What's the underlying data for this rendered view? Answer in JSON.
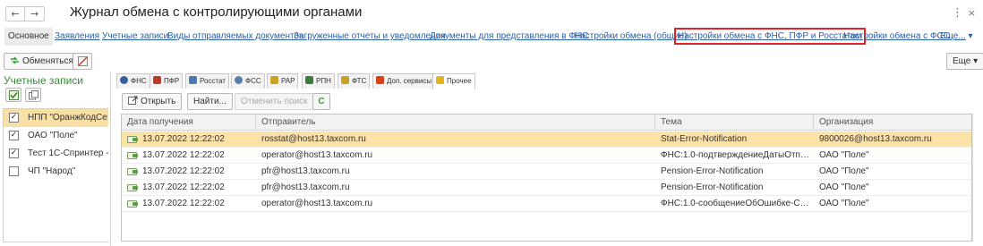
{
  "window": {
    "title": "Журнал обмена с контролирующими органами",
    "back_glyph": "←",
    "forward_glyph": "→",
    "more_glyph": "⋮",
    "close_glyph": "×"
  },
  "nav": {
    "items": [
      {
        "label": "Основное",
        "active": true
      },
      {
        "label": "Заявления"
      },
      {
        "label": "Учетные записи"
      },
      {
        "label": "Виды отправляемых документов"
      },
      {
        "label": "Загруженные отчеты и уведомления"
      },
      {
        "label": "Документы для представления в ФНС"
      },
      {
        "label": "Настройки обмена (общие)"
      },
      {
        "label": "Настройки обмена с ФНС, ПФР и Росстатом",
        "highlighted": true
      },
      {
        "label": "Настройки обмена с ФСС"
      },
      {
        "label": "Еще..."
      }
    ],
    "more_arrow": "▾",
    "highlight_color": "#e2232a"
  },
  "toolbar": {
    "exchange_label": "Обменяться",
    "more_label": "Еще",
    "more_arrow": "▾"
  },
  "accounts": {
    "title": "Учетные записи",
    "items": [
      {
        "label": "НПП \"ОранжКодСе...",
        "checked": true,
        "selected": true
      },
      {
        "label": "ОАО \"Поле\"",
        "checked": true
      },
      {
        "label": "Тест 1С-Спринтер - ...",
        "checked": true
      },
      {
        "label": "ЧП \"Народ\"",
        "checked": false
      }
    ],
    "check_glyph": "✓"
  },
  "tabs": [
    {
      "label": "ФНС",
      "icon": "fns-icon",
      "color": "#3a5fa0"
    },
    {
      "label": "ПФР",
      "icon": "pfr-icon",
      "color": "#c0392b"
    },
    {
      "label": "Росстат",
      "icon": "rosstat-icon",
      "color": "#4a7ab0"
    },
    {
      "label": "ФСС",
      "icon": "fss-icon",
      "color": "#5a7ea8"
    },
    {
      "label": "РАР",
      "icon": "rar-icon",
      "color": "#c9a227"
    },
    {
      "label": "РПН",
      "icon": "rpn-icon",
      "color": "#3b7d3b"
    },
    {
      "label": "ФТС",
      "icon": "fts-icon",
      "color": "#c9a227"
    },
    {
      "label": "Доп. сервисы",
      "icon": "services-icon",
      "color": "#d84315"
    },
    {
      "label": "Прочее",
      "icon": "other-icon",
      "color": "#e6b422",
      "active": true
    }
  ],
  "actions": {
    "open_label": "Открыть",
    "find_label": "Найти...",
    "cancel_search_label": "Отменить поиск",
    "refresh_glyph": "C"
  },
  "grid": {
    "columns": [
      "Дата получения",
      "Отправитель",
      "Тема",
      "Организация"
    ],
    "rows": [
      {
        "date": "13.07.2022 12:22:02",
        "sender": "rosstat@host13.taxcom.ru",
        "subject": "Stat-Error-Notification",
        "org": "9800026@host13.taxcom.ru",
        "selected": true
      },
      {
        "date": "13.07.2022 12:22:02",
        "sender": "operator@host13.taxcom.ru",
        "subject": "ФНС:1.0-подтверждениеДатыОтправки-П...",
        "org": "ОАО \"Поле\""
      },
      {
        "date": "13.07.2022 12:22:02",
        "sender": "pfr@host13.taxcom.ru",
        "subject": "Pension-Error-Notification",
        "org": "ОАО \"Поле\""
      },
      {
        "date": "13.07.2022 12:22:02",
        "sender": "pfr@host13.taxcom.ru",
        "subject": "Pension-Error-Notification",
        "org": "ОАО \"Поле\""
      },
      {
        "date": "13.07.2022 12:22:02",
        "sender": "operator@host13.taxcom.ru",
        "subject": "ФНС:1.0-сообщениеОбОшибке-Сообщен...",
        "org": "ОАО \"Поле\""
      }
    ],
    "selected_color": "#fbe3a8"
  }
}
